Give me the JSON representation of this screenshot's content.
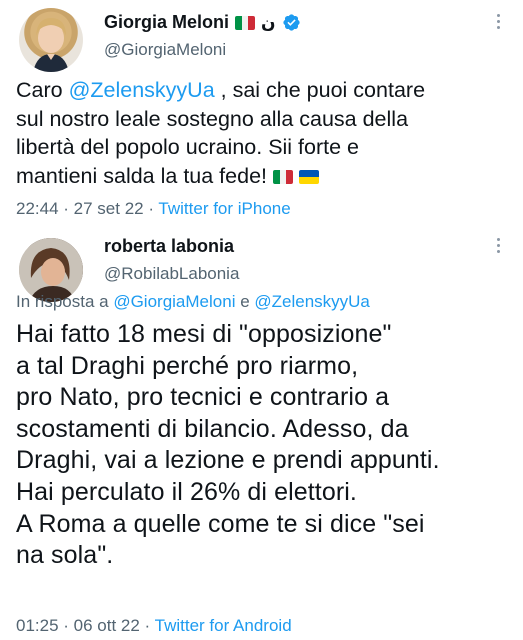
{
  "tweets": [
    {
      "display_name": "Giorgia Meloni",
      "name_suffix": "ن",
      "handle": "@GiorgiaMeloni",
      "text_before_mention": "Caro ",
      "mention": "@ZelenskyyUa",
      "text_lines": [
        " , sai che puoi contare",
        "sul nostro leale sostegno alla causa della",
        "libertà del popolo ucraino. Sii forte e",
        "mantieni salda la tua fede! "
      ],
      "time": "22:44",
      "separator": " · ",
      "date": "27 set 22",
      "source": "Twitter for iPhone"
    },
    {
      "display_name": "roberta labonia",
      "handle": "@RobilabLabonia",
      "reply_prefix": "In risposta a ",
      "reply_mention_1": "@GiorgiaMeloni",
      "reply_conj": " e ",
      "reply_mention_2": "@ZelenskyyUa",
      "text_lines": [
        "Hai fatto 18 mesi di \"opposizione\"",
        "a tal Draghi perché pro riarmo,",
        "pro Nato, pro tecnici e contrario a",
        "scostamenti di bilancio. Adesso, da",
        "Draghi, vai a lezione e prendi appunti.",
        "Hai perculato il 26% di elettori.",
        "A Roma a quelle come te si dice \"sei",
        "na sola\"."
      ],
      "time": "01:25",
      "separator": " · ",
      "date": "06 ott 22",
      "source": "Twitter for Android"
    }
  ],
  "colors": {
    "accent": "#1d9bf0",
    "secondary_text": "#536471",
    "primary_text": "#0f1419"
  },
  "icons": [
    "italy-flag-icon",
    "ukraine-flag-icon",
    "verified-badge-icon",
    "more-options-icon"
  ]
}
